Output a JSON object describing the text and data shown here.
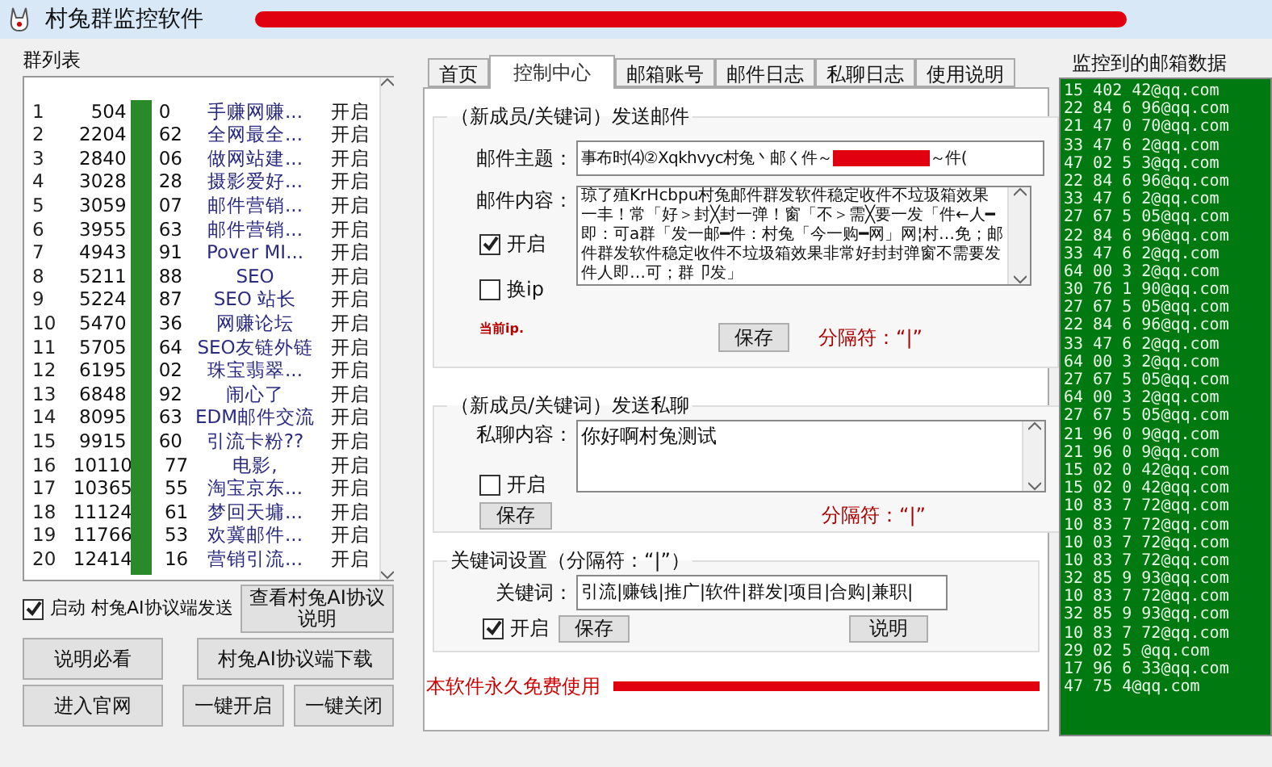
{
  "window": {
    "title": "村兔群监控软件"
  },
  "group_list": {
    "title": "群列表",
    "rows": [
      {
        "num": "1",
        "id_head": "504",
        "id_tail": "0",
        "name": "手赚网赚...",
        "status": "开启"
      },
      {
        "num": "2",
        "id_head": "2204",
        "id_tail": "62",
        "name": "全网最全...",
        "status": "开启"
      },
      {
        "num": "3",
        "id_head": "2840",
        "id_tail": "06",
        "name": "做网站建...",
        "status": "开启"
      },
      {
        "num": "4",
        "id_head": "3028",
        "id_tail": "28",
        "name": "摄影爱好...",
        "status": "开启"
      },
      {
        "num": "5",
        "id_head": "3059",
        "id_tail": "07",
        "name": "邮件营销...",
        "status": "开启"
      },
      {
        "num": "6",
        "id_head": "3955",
        "id_tail": "63",
        "name": "邮件营销...",
        "status": "开启"
      },
      {
        "num": "7",
        "id_head": "4943",
        "id_tail": "91",
        "name": "Pover MI...",
        "status": "开启"
      },
      {
        "num": "8",
        "id_head": "5211",
        "id_tail": "88",
        "name": "SEO",
        "status": "开启"
      },
      {
        "num": "9",
        "id_head": "5224",
        "id_tail": "87",
        "name": "SEO 站长",
        "status": "开启"
      },
      {
        "num": "10",
        "id_head": "5470",
        "id_tail": "36",
        "name": "网赚论坛",
        "status": "开启"
      },
      {
        "num": "11",
        "id_head": "5705",
        "id_tail": "64",
        "name": "SEO友链外链",
        "status": "开启"
      },
      {
        "num": "12",
        "id_head": "6195",
        "id_tail": "02",
        "name": "珠宝翡翠...",
        "status": "开启"
      },
      {
        "num": "13",
        "id_head": "6848",
        "id_tail": "92",
        "name": "闹心了",
        "status": "开启"
      },
      {
        "num": "14",
        "id_head": "8095",
        "id_tail": "63",
        "name": "EDM邮件交流",
        "status": "开启"
      },
      {
        "num": "15",
        "id_head": "9915",
        "id_tail": "60",
        "name": "引流卡粉??",
        "status": "开启"
      },
      {
        "num": "16",
        "id_head": "10110",
        "id_tail": "77",
        "name": "电影,",
        "status": "开启"
      },
      {
        "num": "17",
        "id_head": "10365",
        "id_tail": "55",
        "name": "淘宝京东...",
        "status": "开启"
      },
      {
        "num": "18",
        "id_head": "11124",
        "id_tail": "61",
        "name": "梦回天墉...",
        "status": "开启"
      },
      {
        "num": "19",
        "id_head": "11766",
        "id_tail": "53",
        "name": "欢冀邮件...",
        "status": "开启"
      },
      {
        "num": "20",
        "id_head": "12414",
        "id_tail": "16",
        "name": "营销引流...",
        "status": "开启"
      }
    ]
  },
  "ai_send": {
    "label": "启动 村兔AI协议端发送",
    "checked": true
  },
  "left_buttons": [
    "查看村兔AI协议说明",
    "说明必看",
    "村兔AI协议端下载",
    "进入官网",
    "一键开启",
    "一键关闭"
  ],
  "tabs": [
    {
      "label": "首页",
      "selected": false
    },
    {
      "label": "控制中心",
      "selected": true
    },
    {
      "label": "邮箱账号",
      "selected": false
    },
    {
      "label": "邮件日志",
      "selected": false
    },
    {
      "label": "私聊日志",
      "selected": false
    },
    {
      "label": "使用说明",
      "selected": false
    }
  ],
  "mail_group": {
    "title": "（新成员/关键词）发送邮件",
    "subject_label": "邮件主题：",
    "subject_start": "事布时⑷②Xqkhvyc村兔丶邮く件～",
    "subject_end": "～件(",
    "content_label": "邮件内容：",
    "content": "琼了殖KrHcbpu村兔邮件群发软件稳定收件不垃圾箱效果一丰！常「好＞封╳封一弹！窗「不＞需╳要一发「件←人━即：可a群「发一邮━件：村兔「今一购━网」网¦村…免；邮件群发软件稳定收件不垃圾箱效果非常好封封弹窗不需要发件人即…可；群卩发」",
    "enable": {
      "label": "开启",
      "checked": true
    },
    "change_ip": {
      "label": "换ip",
      "checked": false
    },
    "ip_note": "当前ip.",
    "save": "保存",
    "separator": "分隔符：“|”"
  },
  "chat_group": {
    "title": "（新成员/关键词）发送私聊",
    "content_label": "私聊内容：",
    "content": "你好啊村兔测试",
    "enable": {
      "label": "开启",
      "checked": false
    },
    "save": "保存",
    "separator": "分隔符：“|”"
  },
  "keyword_group": {
    "title": "关键词设置（分隔符：“|”）",
    "label": "关键词：",
    "value": "引流|赚钱|推广|软件|群发|项目|合购|兼职|",
    "enable": {
      "label": "开启",
      "checked": true
    },
    "save": "保存",
    "help": "说明"
  },
  "footer": "本软件永久免费使用",
  "emails": {
    "title": "监控到的邮箱数据",
    "items": [
      "15 402 42@qq.com",
      "22 84 6 96@qq.com",
      "21 47 0 70@qq.com",
      "33 47 6 2@qq.com",
      "47 02 5 3@qq.com",
      "22 84 6 96@qq.com",
      "33 47 6 2@qq.com",
      "27 67 5 05@qq.com",
      "22 84 6 96@qq.com",
      "33 47 6 2@qq.com",
      "64 00 3 2@qq.com",
      "30 76 1 90@qq.com",
      "27 67 5 05@qq.com",
      "22 84 6 96@qq.com",
      "33 47 6 2@qq.com",
      "64 00 3 2@qq.com",
      "27 67 5 05@qq.com",
      "64 00 3 2@qq.com",
      "27 67 5 05@qq.com",
      "21 96 0 9@qq.com",
      "21 96 0 9@qq.com",
      "15 02 0 42@qq.com",
      "15 02 0 42@qq.com",
      "10 83 7 72@qq.com",
      "10 83 7 72@qq.com",
      "10 03 7 72@qq.com",
      "10 83 7 72@qq.com",
      "32 85 9 93@qq.com",
      "10 83 7 72@qq.com",
      "32 85 9 93@qq.com",
      "10 83 7 72@qq.com",
      "29 02 5 @qq.com",
      "17 96 6 33@qq.com",
      "47 75 4@qq.com"
    ]
  }
}
